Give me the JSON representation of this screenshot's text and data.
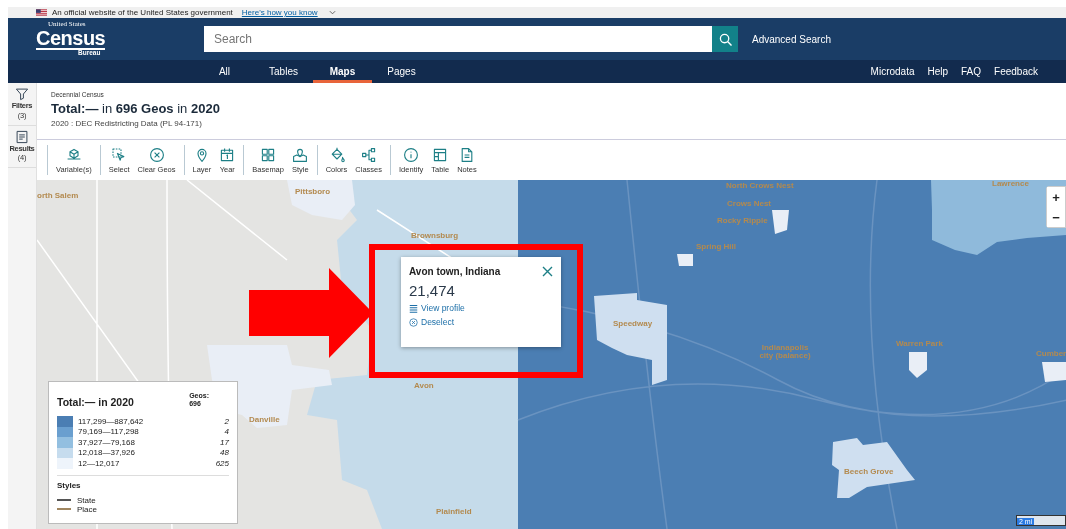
{
  "gov_banner": {
    "text": "An official website of the United States government",
    "link": "Here's how you know"
  },
  "header": {
    "logo": {
      "top": "United States",
      "main": "Census",
      "bottom": "Bureau"
    },
    "search": {
      "placeholder": "Search"
    },
    "advanced_search": "Advanced Search"
  },
  "nav": {
    "tabs": [
      {
        "label": "All",
        "selected": false
      },
      {
        "label": "Tables",
        "selected": false
      },
      {
        "label": "Maps",
        "selected": true
      },
      {
        "label": "Pages",
        "selected": false
      }
    ],
    "links": [
      "Microdata",
      "Help",
      "FAQ",
      "Feedback"
    ]
  },
  "sidebar": {
    "items": [
      {
        "label": "Filters",
        "count": "(3)"
      },
      {
        "label": "Results",
        "count": "(4)"
      }
    ]
  },
  "page": {
    "kicker": "Decennial Census",
    "title": "**Total:—** in **696 Geos** in **2020**",
    "subtitle": "2020 : DEC Redistricting Data (PL 94-171)"
  },
  "toolbar": {
    "groups": [
      [
        {
          "label": "Variable(s)"
        }
      ],
      [
        {
          "label": "Select"
        },
        {
          "label": "Clear Geos"
        }
      ],
      [
        {
          "label": "Layer"
        },
        {
          "label": "Year"
        }
      ],
      [
        {
          "label": "Basemap"
        },
        {
          "label": "Style"
        }
      ],
      [
        {
          "label": "Colors"
        },
        {
          "label": "Classes"
        }
      ],
      [
        {
          "label": "Identify"
        },
        {
          "label": "Table"
        },
        {
          "label": "Notes"
        }
      ]
    ]
  },
  "map": {
    "labels": [
      "orth Salem",
      "Pittsboro",
      "Brownsburg",
      "Avon",
      "Danville",
      "Plainfield",
      "Speedway",
      "Indianapolis city (balance)",
      "Warren Park",
      "Cumber",
      "Beech Grove",
      "North Crows Nest",
      "Crows Nest",
      "Rocky Ripple",
      "Spring Hill",
      "Lawrence"
    ],
    "zoom_controls": [
      "+",
      "−"
    ],
    "scale": "2 mi",
    "popup": {
      "title": "Avon town, Indiana",
      "value": "21,474",
      "actions": [
        {
          "label": "View profile"
        },
        {
          "label": "Deselect"
        }
      ]
    },
    "legend": {
      "title": "Total:— in 2020",
      "geos_label": "Geos:",
      "geos_count": "696",
      "classes": [
        {
          "range": "117,299—887,642",
          "count": "2",
          "color": "#4b7eb3"
        },
        {
          "range": "79,169—117,298",
          "count": "4",
          "color": "#6a9fcf"
        },
        {
          "range": "37,927—79,168",
          "count": "17",
          "color": "#93bfe0"
        },
        {
          "range": "12,018—37,926",
          "count": "48",
          "color": "#c6dcee"
        },
        {
          "range": "12—12,017",
          "count": "625",
          "color": "#eef4fb"
        }
      ],
      "styles_title": "Styles",
      "styles": [
        {
          "label": "State",
          "color": "#555555"
        },
        {
          "label": "Place",
          "color": "#a08660"
        }
      ]
    }
  }
}
